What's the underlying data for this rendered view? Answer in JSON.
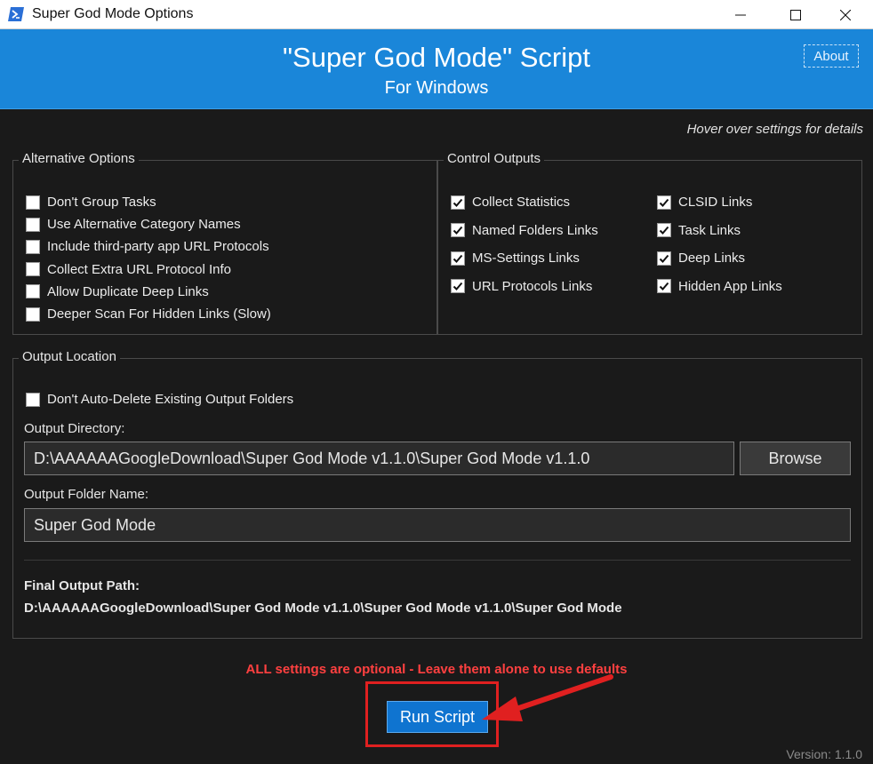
{
  "window": {
    "title": "Super God Mode Options",
    "icon": "powershell-icon"
  },
  "banner": {
    "title": "\"Super God Mode\" Script",
    "subtitle": "For Windows",
    "about_label": "About",
    "color": "#1a86d9"
  },
  "hint": "Hover over settings for details",
  "alternative_options": {
    "legend": "Alternative Options",
    "items": [
      {
        "label": "Don't Group Tasks",
        "checked": false
      },
      {
        "label": "Use Alternative Category Names",
        "checked": false
      },
      {
        "label": "Include third-party app URL Protocols",
        "checked": false
      },
      {
        "label": "Collect Extra URL Protocol Info",
        "checked": false
      },
      {
        "label": "Allow Duplicate Deep Links",
        "checked": false
      },
      {
        "label": "Deeper Scan For Hidden Links (Slow)",
        "checked": false
      }
    ]
  },
  "control_outputs": {
    "legend": "Control Outputs",
    "items": [
      {
        "label": "Collect Statistics",
        "checked": true
      },
      {
        "label": "Named Folders Links",
        "checked": true
      },
      {
        "label": "MS-Settings Links",
        "checked": true
      },
      {
        "label": "URL Protocols Links",
        "checked": true
      },
      {
        "label": "CLSID Links",
        "checked": true
      },
      {
        "label": "Task Links",
        "checked": true
      },
      {
        "label": "Deep Links",
        "checked": true
      },
      {
        "label": "Hidden App Links",
        "checked": true
      }
    ]
  },
  "output_location": {
    "legend": "Output Location",
    "auto_delete_label": "Don't Auto-Delete Existing Output Folders",
    "auto_delete_checked": false,
    "directory_label": "Output Directory:",
    "directory_value": "D:\\AAAAAAGoogleDownload\\Super God Mode v1.1.0\\Super God Mode v1.1.0",
    "browse_label": "Browse",
    "folder_name_label": "Output Folder Name:",
    "folder_name_value": "Super God Mode",
    "final_path_label": "Final Output Path:",
    "final_path_value": "D:\\AAAAAAGoogleDownload\\Super God Mode v1.1.0\\Super God Mode v1.1.0\\Super God Mode"
  },
  "warning": "ALL settings are optional - Leave them alone to use defaults",
  "run_label": "Run Script",
  "version": "Version: 1.1.0",
  "colors": {
    "background": "#1a1a1a",
    "warning": "#ff4040",
    "run_button": "#0f74d0",
    "annotation": "#e02020"
  }
}
